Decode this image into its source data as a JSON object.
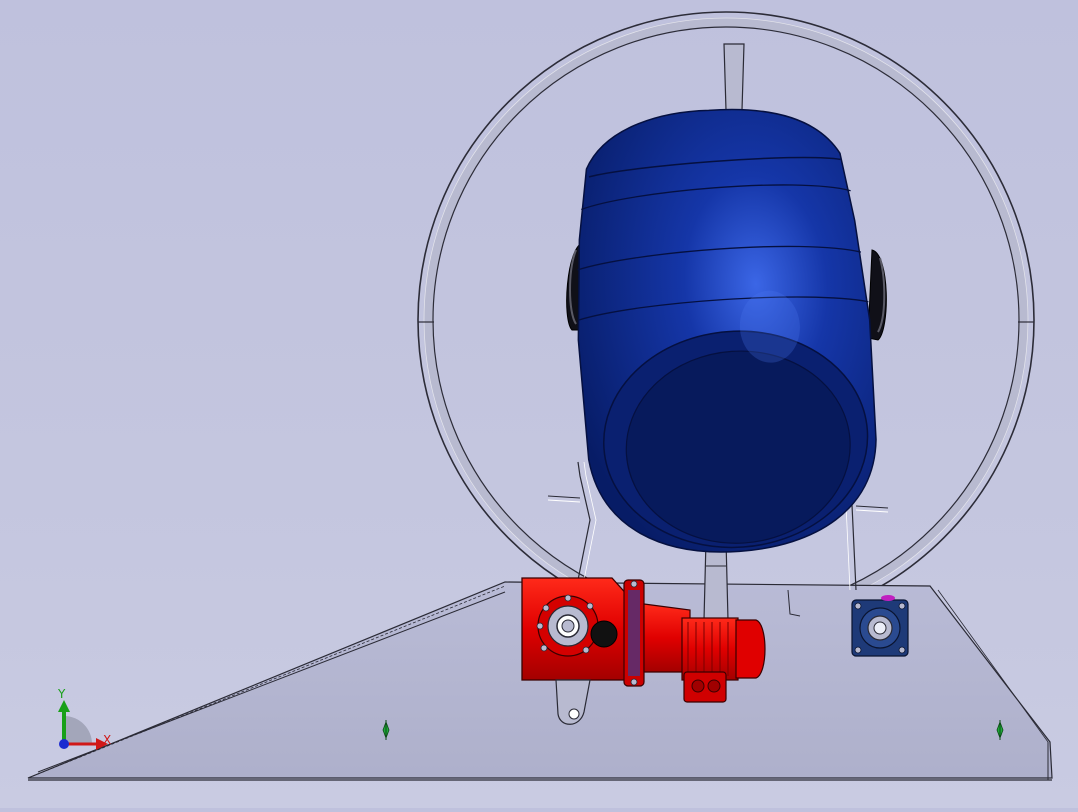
{
  "app": {
    "view": "cad-viewport",
    "background": "#c2c4de"
  },
  "colors": {
    "tank_blue": "#0a2a8c",
    "tank_highlight": "#2a56d8",
    "motor_red": "#e00000",
    "frame_steel": "#b8bad0",
    "outline": "#2a2a35",
    "bearing_blue": "#1e3a78",
    "mate_green": "#1fa83a"
  },
  "triad": {
    "x_label": "X",
    "y_label": "Y",
    "x_color": "#d01818",
    "y_color": "#18a018",
    "z_color": "#1a2ad0"
  },
  "icons": [
    "coordinate-triad-icon",
    "mate-marker-icon"
  ]
}
